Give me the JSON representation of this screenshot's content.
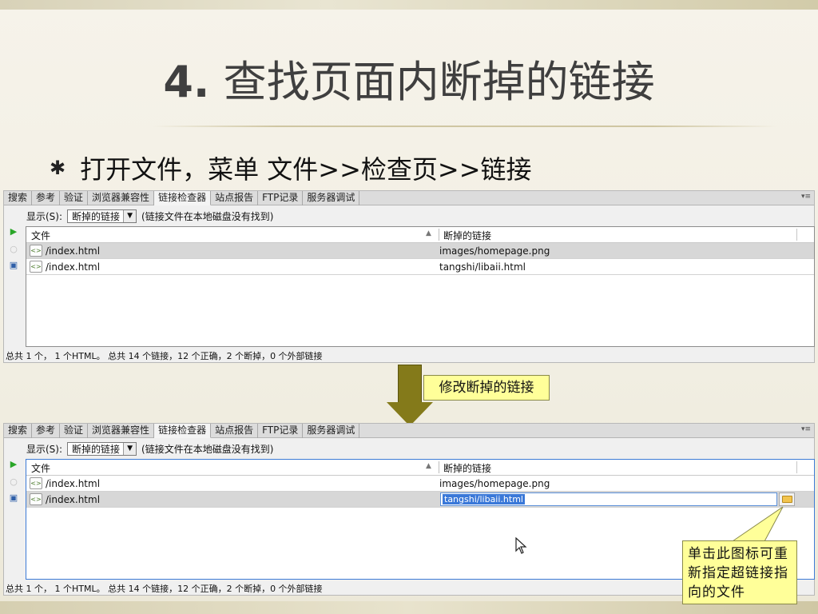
{
  "slide": {
    "title_num": "4.",
    "title_text": " 查找页面内断掉的链接",
    "bullet": "打开文件，菜单 文件>>检查页>>链接"
  },
  "panel": {
    "tabs": [
      "搜索",
      "参考",
      "验证",
      "浏览器兼容性",
      "链接检查器",
      "站点报告",
      "FTP记录",
      "服务器调试"
    ],
    "active_tab": "链接检查器",
    "show_label": "显示(S):",
    "show_value": "断掉的链接",
    "hint": "(链接文件在本地磁盘没有找到)",
    "col_file": "文件",
    "col_broken": "断掉的链接",
    "status": "总共 1 个， 1 个HTML。 总共 14 个链接，12 个正确，2 个断掉，0 个外部链接"
  },
  "rows": [
    {
      "file": "/index.html",
      "link": "images/homepage.png"
    },
    {
      "file": "/index.html",
      "link": "tangshi/libaii.html"
    }
  ],
  "callouts": {
    "fix_links": "修改断掉的链接",
    "folder_tip": "单击此图标可重新指定超链接指向的文件"
  },
  "icons": {
    "file_icon": "html-file-icon",
    "folder_icon": "folder-icon",
    "play_icon": "play-icon",
    "save_icon": "save-icon"
  }
}
